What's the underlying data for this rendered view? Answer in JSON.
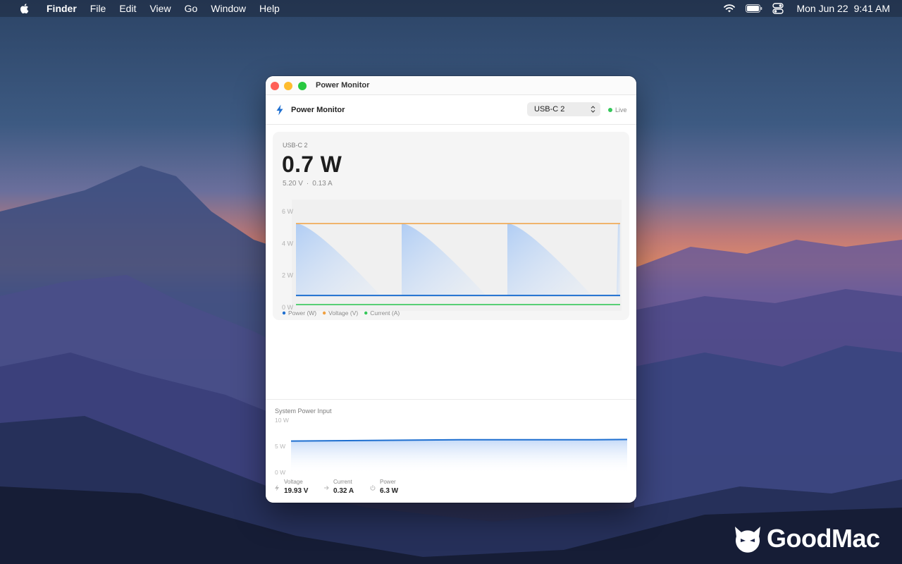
{
  "menubar": {
    "app_name": "Finder",
    "items": [
      "File",
      "Edit",
      "View",
      "Go",
      "Window",
      "Help"
    ],
    "date": "Mon Jun 22",
    "time": "9:41 AM"
  },
  "window": {
    "title": "Power Monitor",
    "toolbar": {
      "app_title": "Power Monitor",
      "port_selected": "USB-C 2",
      "live_label": "Live"
    },
    "port_card": {
      "port_name": "USB-C 2",
      "power": "0.7 W",
      "voltage": "5.20 V",
      "current": "0.13 A",
      "separator": "·"
    },
    "system_power": {
      "title": "System Power Input",
      "stats": [
        {
          "label": "Voltage",
          "value": "19.93 V",
          "icon": "bolt-icon"
        },
        {
          "label": "Current",
          "value": "0.32 A",
          "icon": "arrow-right-icon"
        },
        {
          "label": "Power",
          "value": "6.3 W",
          "icon": "power-icon"
        }
      ]
    }
  },
  "chart_data": [
    {
      "type": "line",
      "title": "",
      "y_ticks": [
        "6 W",
        "4 W",
        "2 W",
        "0 W"
      ],
      "ylim": [
        0,
        6
      ],
      "x": [
        0,
        1,
        2,
        3,
        4,
        5,
        6,
        7,
        8,
        9,
        10
      ],
      "series": [
        {
          "name": "Power (W)",
          "color": "#1e6fd0",
          "values": [
            0.7,
            0.7,
            0.7,
            0.7,
            0.7,
            0.7,
            0.7,
            0.7,
            0.7,
            0.7,
            0.7
          ]
        },
        {
          "name": "Voltage (V)",
          "color": "#f0a040",
          "values": [
            5.2,
            5.2,
            5.2,
            5.2,
            5.2,
            5.2,
            5.2,
            5.2,
            5.2,
            5.2,
            5.2
          ]
        },
        {
          "name": "Current (A)",
          "color": "#34c759",
          "values": [
            0.13,
            0.13,
            0.13,
            0.13,
            0.13,
            0.13,
            0.13,
            0.13,
            0.13,
            0.13,
            0.13
          ]
        }
      ],
      "legend": "bottom-left",
      "grid": false
    },
    {
      "type": "area",
      "title": "System Power Input",
      "y_ticks": [
        "10 W",
        "5 W",
        "0 W"
      ],
      "ylim": [
        0,
        10
      ],
      "x": [
        0,
        1,
        2,
        3,
        4,
        5,
        6,
        7,
        8,
        9,
        10
      ],
      "series": [
        {
          "color": "#1e6fd0",
          "values": [
            6.0,
            6.05,
            6.1,
            6.15,
            6.2,
            6.25,
            6.25,
            6.25,
            6.25,
            6.25,
            6.3
          ]
        }
      ],
      "grid": false
    }
  ],
  "colors": {
    "accent": "#1e6fd0",
    "voltage": "#f0a040",
    "current": "#34c759",
    "live": "#34c759"
  },
  "brand": {
    "name": "GoodMac"
  }
}
